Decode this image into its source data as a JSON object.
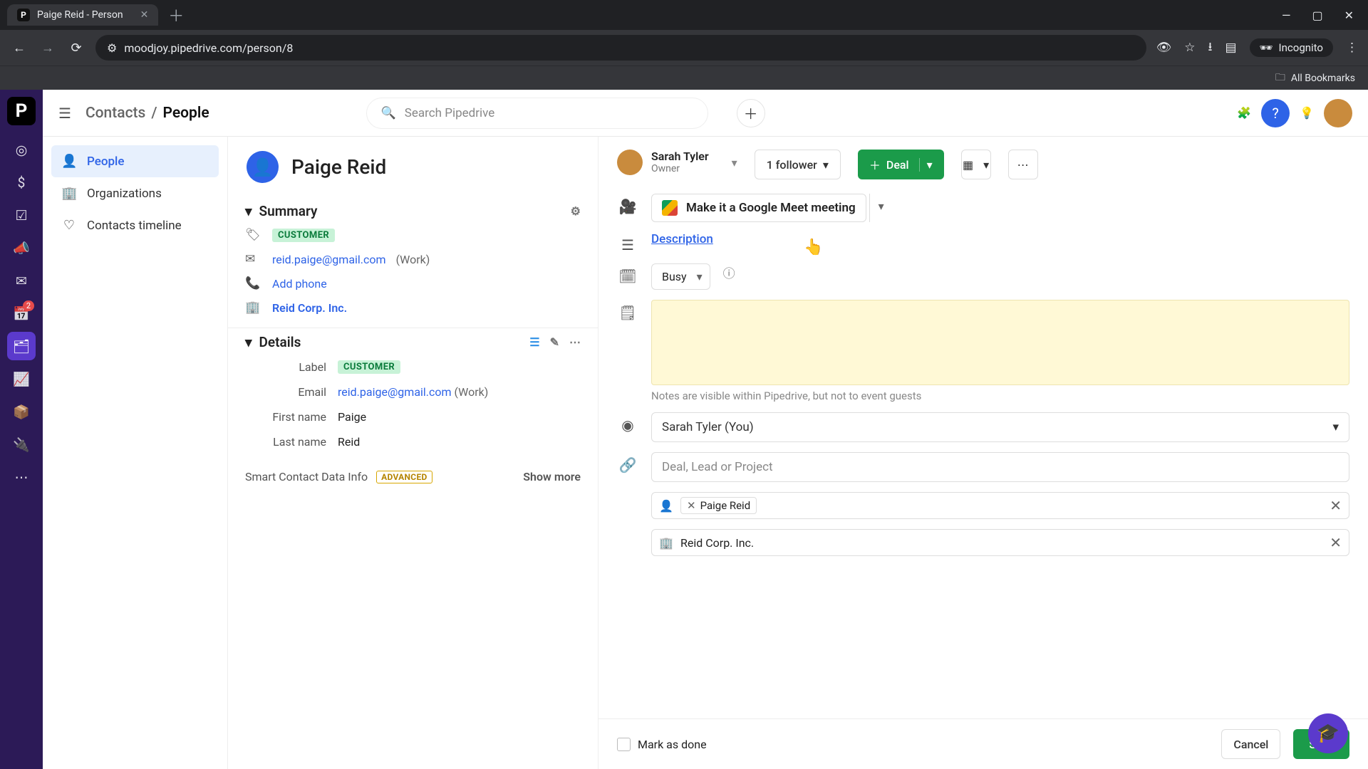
{
  "browser": {
    "tab_title": "Paige Reid - Person",
    "tab_favicon_letter": "P",
    "url": "moodjoy.pipedrive.com/person/8",
    "incognito_label": "Incognito",
    "bookmarks_label": "All Bookmarks"
  },
  "header": {
    "breadcrumb_root": "Contacts",
    "breadcrumb_sep": "/",
    "breadcrumb_current": "People",
    "search_placeholder": "Search Pipedrive"
  },
  "rail": {
    "notification_badge": "2"
  },
  "subnav": {
    "items": [
      {
        "label": "People"
      },
      {
        "label": "Organizations"
      },
      {
        "label": "Contacts timeline"
      }
    ]
  },
  "person": {
    "name": "Paige Reid",
    "summary_title": "Summary",
    "label_chip": "CUSTOMER",
    "email": "reid.paige@gmail.com",
    "email_type": "(Work)",
    "add_phone": "Add phone",
    "organization": "Reid Corp. Inc.",
    "details_title": "Details",
    "details": {
      "label_label": "Label",
      "label_value": "CUSTOMER",
      "email_label": "Email",
      "email_value": "reid.paige@gmail.com",
      "email_type": "(Work)",
      "first_name_label": "First name",
      "first_name_value": "Paige",
      "last_name_label": "Last name",
      "last_name_value": "Reid"
    },
    "smart_contact_label": "Smart Contact Data Info",
    "advanced_chip": "ADVANCED",
    "show_more": "Show more"
  },
  "activity_header": {
    "owner_name": "Sarah Tyler",
    "owner_role": "Owner",
    "followers": "1 follower",
    "deal_label": "Deal"
  },
  "activity_form": {
    "gmeet_label": "Make it a Google Meet meeting",
    "description_link": "Description",
    "busy_value": "Busy",
    "notes_hint": "Notes are visible within Pipedrive, but not to event guests",
    "owner_value": "Sarah Tyler (You)",
    "link_placeholder": "Deal, Lead or Project",
    "contact_chip": "Paige Reid",
    "org_value": "Reid Corp. Inc."
  },
  "footer": {
    "mark_done": "Mark as done",
    "cancel": "Cancel",
    "save": "Save"
  }
}
